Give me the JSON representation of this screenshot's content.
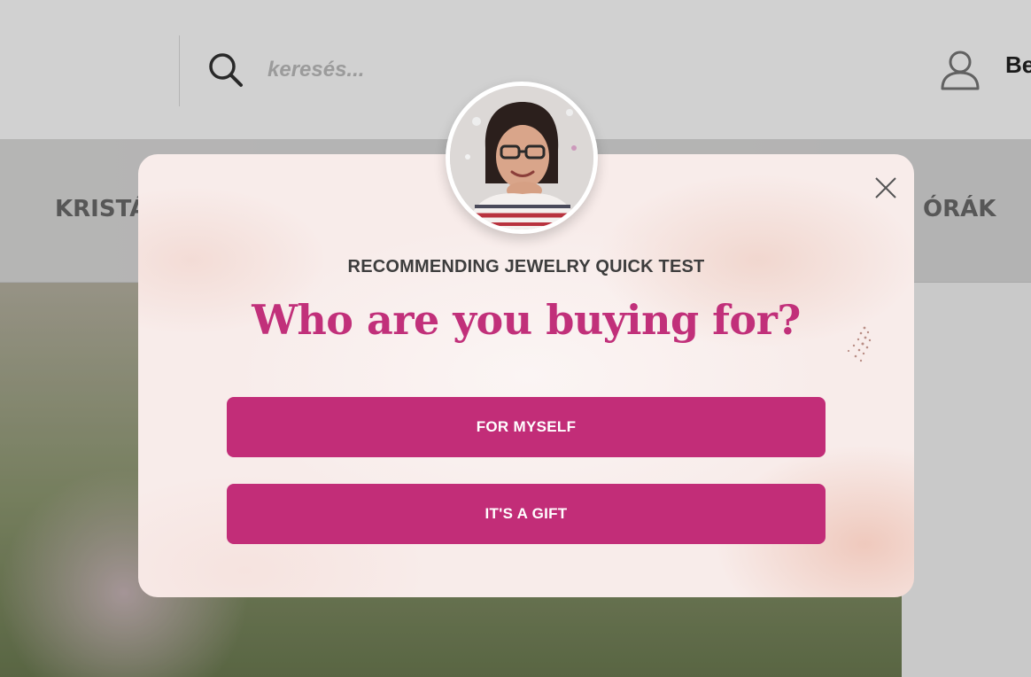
{
  "header": {
    "search": {
      "placeholder": "keresés..."
    },
    "login_label": "Be"
  },
  "nav": {
    "left_item": "KRISTÁ",
    "right_item": "ÓRÁK"
  },
  "modal": {
    "kicker": "RECOMMENDING JEWELRY QUICK TEST",
    "title": "Who are you buying for?",
    "options": [
      {
        "label": "FOR MYSELF"
      },
      {
        "label": "IT'S A GIFT"
      }
    ]
  },
  "icons": {
    "search": "search-icon",
    "user": "user-icon",
    "close": "close-icon",
    "sparkle": "sparkle-icon"
  },
  "colors": {
    "accent": "#c22d78",
    "title": "#c1307a",
    "kicker": "#3d3d3d"
  }
}
